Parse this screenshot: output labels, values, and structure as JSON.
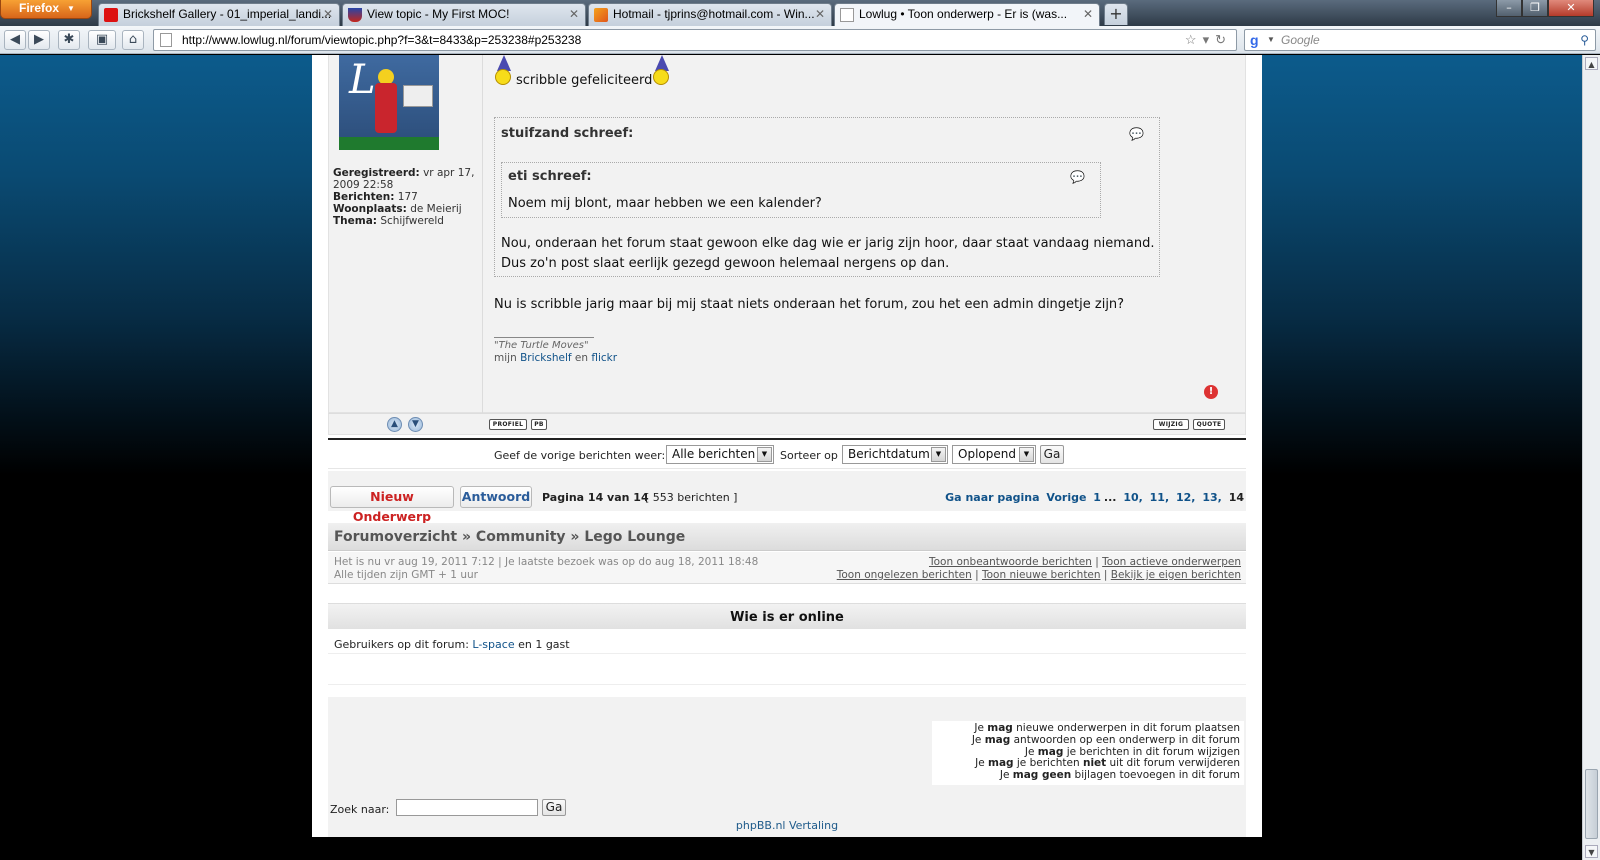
{
  "browser": {
    "menu_button": "Firefox",
    "tabs": [
      {
        "title": "Brickshelf Gallery - 01_imperial_landi...",
        "icon": "brickshelf-favicon"
      },
      {
        "title": "View topic - My First MOC!",
        "icon": "shield-favicon"
      },
      {
        "title": "Hotmail - tjprins@hotmail.com - Win...",
        "icon": "hotmail-favicon"
      },
      {
        "title": "Lowlug • Toon onderwerp - Er is (was...",
        "icon": "page-favicon"
      }
    ],
    "new_tab": "+",
    "url": "http://www.lowlug.nl/forum/viewtopic.php?f=3&t=8433&p=253238#p253238",
    "search_placeholder": "Google"
  },
  "post": {
    "profile": {
      "registered_label": "Geregistreerd:",
      "registered_value": "vr apr 17, 2009 22:58",
      "posts_label": "Berichten:",
      "posts_value": "177",
      "location_label": "Woonplaats:",
      "location_value": "de Meierij",
      "theme_label": "Thema:",
      "theme_value": "Schijfwereld"
    },
    "intro": "scribble gefeliciteerd",
    "outer_quote": {
      "author": "stuifzand schreef:",
      "inner_quote": {
        "author": "eti schreef:",
        "text": "Noem mij blont, maar hebben we een kalender?"
      },
      "text_line1": "Nou, onderaan het forum staat gewoon elke dag wie er jarig zijn hoor, daar staat vandaag niemand.",
      "text_line2": "Dus zo'n post slaat eerlijk gezegd gewoon helemaal nergens op dan."
    },
    "body": "Nu is scribble jarig maar bij mij staat niets onderaan het forum, zou het een admin dingetje zijn?",
    "signature": {
      "quote": "\"The Turtle Moves\"",
      "prefix": "mijn",
      "link1": "Brickshelf",
      "middle": "en",
      "link2": "flickr"
    },
    "toolbar": {
      "profile": "PROFIEL",
      "pm": "PB",
      "edit": "WIJZIG",
      "quote": "QUOTE"
    }
  },
  "sort": {
    "show_label": "Geef de vorige berichten weer:",
    "show_value": "Alle berichten",
    "sort_label": "Sorteer op",
    "sort_value": "Berichtdatum",
    "order_value": "Oplopend",
    "go": "Ga"
  },
  "actions": {
    "new_topic": "Nieuw Onderwerp",
    "reply": "Antwoord",
    "page_info": "Pagina 14 van 14",
    "post_count": "[ 553 berichten ]"
  },
  "pagination": {
    "label": "Ga naar pagina",
    "prev": "Vorige",
    "pages": [
      "1",
      "...",
      "10,",
      "11,",
      "12,",
      "13,"
    ],
    "current": "14"
  },
  "breadcrumb": "Forumoverzicht » Community » Lego Lounge",
  "timeinfo": {
    "line1": "Het is nu vr aug 19, 2011 7:12 | Je laatste bezoek was op do aug 18, 2011 18:48",
    "line2": "Alle tijden zijn GMT + 1 uur",
    "links_row1": [
      "Toon onbeantwoorde berichten",
      "Toon actieve onderwerpen"
    ],
    "links_row2": [
      "Toon ongelezen berichten",
      "Toon nieuwe berichten",
      "Bekijk je eigen berichten"
    ]
  },
  "who_is_online": {
    "title": "Wie is er online",
    "prefix": "Gebruikers op dit forum:",
    "user": "L-space",
    "suffix": "en 1 gast"
  },
  "permissions": [
    {
      "pre": "Je",
      "bold": "mag",
      "post": "nieuwe onderwerpen in dit forum plaatsen"
    },
    {
      "pre": "Je",
      "bold": "mag",
      "post": "antwoorden op een onderwerp in dit forum"
    },
    {
      "pre": "Je",
      "bold": "mag",
      "post": "je berichten in dit forum wijzigen"
    },
    {
      "pre": "Je",
      "bold": "mag",
      "post": "je berichten",
      "bold2": "niet",
      "post2": "uit dit forum verwijderen"
    },
    {
      "pre": "Je",
      "bold": "mag geen",
      "post": "bijlagen toevoegen in dit forum"
    }
  ],
  "search": {
    "label": "Zoek naar:",
    "go": "Ga"
  },
  "footer": "phpBB.nl Vertaling"
}
